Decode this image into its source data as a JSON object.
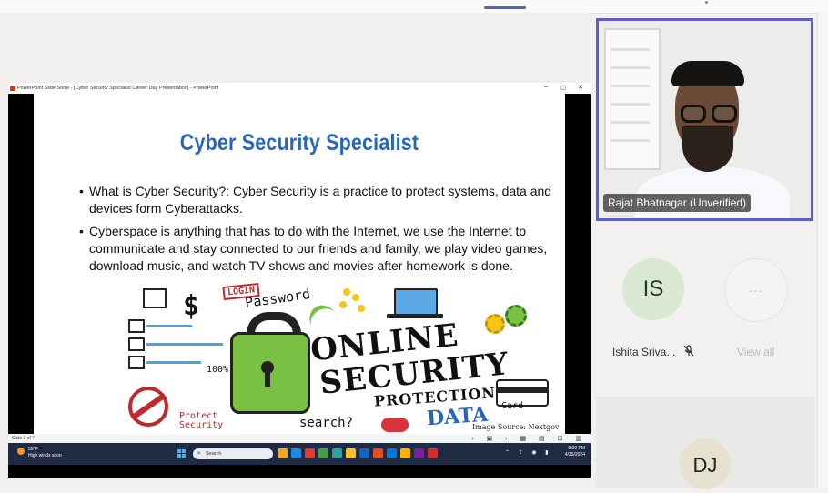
{
  "powerpoint": {
    "window_title": "PowerPoint Slide Show - [Cyber Security Specialist Career Day Presentation] - PowerPoint",
    "minimize": "–",
    "restore": "◻",
    "close": "✕",
    "slide_indicator": "Slide 1 of 7",
    "status_icons": "‹ ▣ › ▦ ▤ ⊟ ▥"
  },
  "slide": {
    "title": "Cyber Security Specialist",
    "bullets": [
      "What is Cyber Security?: Cyber Security is a practice to protect systems, data and devices form Cyberattacks.",
      "Cyberspace is anything that has to do with the Internet, we use the Internet to communicate and stay connected to our friends and family, we play video games, download music, and watch TV shows and movies after homework is done."
    ],
    "image": {
      "online": "ONLINE",
      "security": "SECURITY",
      "protection": "PROTECTION",
      "data": "DATA",
      "password": "Password",
      "login": "LOGIN",
      "dollar": "$",
      "percent": "100%",
      "search": "search?",
      "card": "Card",
      "protect": "Protect\nSecurity",
      "credit": "Image Source: Nextgov"
    }
  },
  "taskbar": {
    "weather_temp": "59°F",
    "weather_desc": "High winds soon",
    "search_placeholder": "Search",
    "tray": "⌃ ⇪ ◉ ▮",
    "time": "9:09 PM",
    "date": "4/25/2024",
    "app_colors": [
      "#f5a623",
      "#1e88e5",
      "#e53935",
      "#43a047",
      "#26a69a",
      "#fbc02d",
      "#1565c0",
      "#e64a19",
      "#0078d4",
      "#ffb300",
      "#7b1fa2",
      "#d32f2f"
    ]
  },
  "meeting": {
    "presenter_name": "Rajat Bhatnagar (Unverified)",
    "participant_initials": "IS",
    "participant_name": "Ishita Sriva...",
    "more_label": "···",
    "view_all": "View all",
    "third_initials": "DJ"
  },
  "colors": {
    "accent": "#5b5fc7",
    "slide_title": "#2766b8",
    "lock_green": "#7ac143"
  }
}
